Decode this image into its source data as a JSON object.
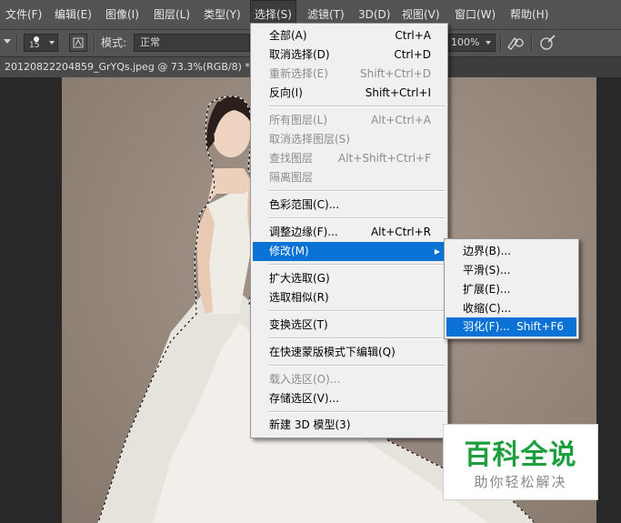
{
  "menubar": {
    "items": [
      {
        "label": "文件(F)"
      },
      {
        "label": "编辑(E)"
      },
      {
        "label": "图像(I)"
      },
      {
        "label": "图层(L)"
      },
      {
        "label": "类型(Y)"
      },
      {
        "label": "选择(S)"
      },
      {
        "label": "滤镜(T)"
      },
      {
        "label": "3D(D)"
      },
      {
        "label": "视图(V)"
      },
      {
        "label": "窗口(W)"
      },
      {
        "label": "帮助(H)"
      }
    ]
  },
  "options": {
    "brush_size": "15",
    "mode_label": "模式:",
    "mode_value": "正常",
    "opacity_value": "100%"
  },
  "document": {
    "tab_title": "20120822204859_GrYQs.jpeg @ 73.3%(RGB/8) *"
  },
  "select_menu": {
    "items": [
      {
        "label": "全部(A)",
        "shortcut": "Ctrl+A",
        "disabled": false
      },
      {
        "label": "取消选择(D)",
        "shortcut": "Ctrl+D",
        "disabled": false
      },
      {
        "label": "重新选择(E)",
        "shortcut": "Shift+Ctrl+D",
        "disabled": true
      },
      {
        "label": "反向(I)",
        "shortcut": "Shift+Ctrl+I",
        "disabled": false
      },
      {
        "label": "所有图层(L)",
        "shortcut": "Alt+Ctrl+A",
        "disabled": true
      },
      {
        "label": "取消选择图层(S)",
        "shortcut": "",
        "disabled": true
      },
      {
        "label": "查找图层",
        "shortcut": "Alt+Shift+Ctrl+F",
        "disabled": true
      },
      {
        "label": "隔离图层",
        "shortcut": "",
        "disabled": true
      },
      {
        "label": "色彩范围(C)...",
        "shortcut": "",
        "disabled": false
      },
      {
        "label": "调整边缘(F)...",
        "shortcut": "Alt+Ctrl+R",
        "disabled": false
      },
      {
        "label": "修改(M)",
        "shortcut": "",
        "disabled": false,
        "highlighted": true,
        "submenu": true
      },
      {
        "label": "扩大选取(G)",
        "shortcut": "",
        "disabled": false
      },
      {
        "label": "选取相似(R)",
        "shortcut": "",
        "disabled": false
      },
      {
        "label": "变换选区(T)",
        "shortcut": "",
        "disabled": false
      },
      {
        "label": "在快速蒙版模式下编辑(Q)",
        "shortcut": "",
        "disabled": false
      },
      {
        "label": "载入选区(O)...",
        "shortcut": "",
        "disabled": true
      },
      {
        "label": "存储选区(V)...",
        "shortcut": "",
        "disabled": false
      },
      {
        "label": "新建 3D 模型(3)",
        "shortcut": "",
        "disabled": false
      }
    ]
  },
  "modify_submenu": {
    "items": [
      {
        "label": "边界(B)...",
        "shortcut": ""
      },
      {
        "label": "平滑(S)...",
        "shortcut": ""
      },
      {
        "label": "扩展(E)...",
        "shortcut": ""
      },
      {
        "label": "收缩(C)...",
        "shortcut": ""
      },
      {
        "label": "羽化(F)...",
        "shortcut": "Shift+F6",
        "highlighted": true
      }
    ]
  },
  "watermark": {
    "title": "百科全说",
    "subtitle": "助你轻松解决"
  },
  "colors": {
    "menu_highlight": "#0a72d4",
    "ui_dark": "#535353",
    "watermark_green": "#1e9e3e"
  }
}
